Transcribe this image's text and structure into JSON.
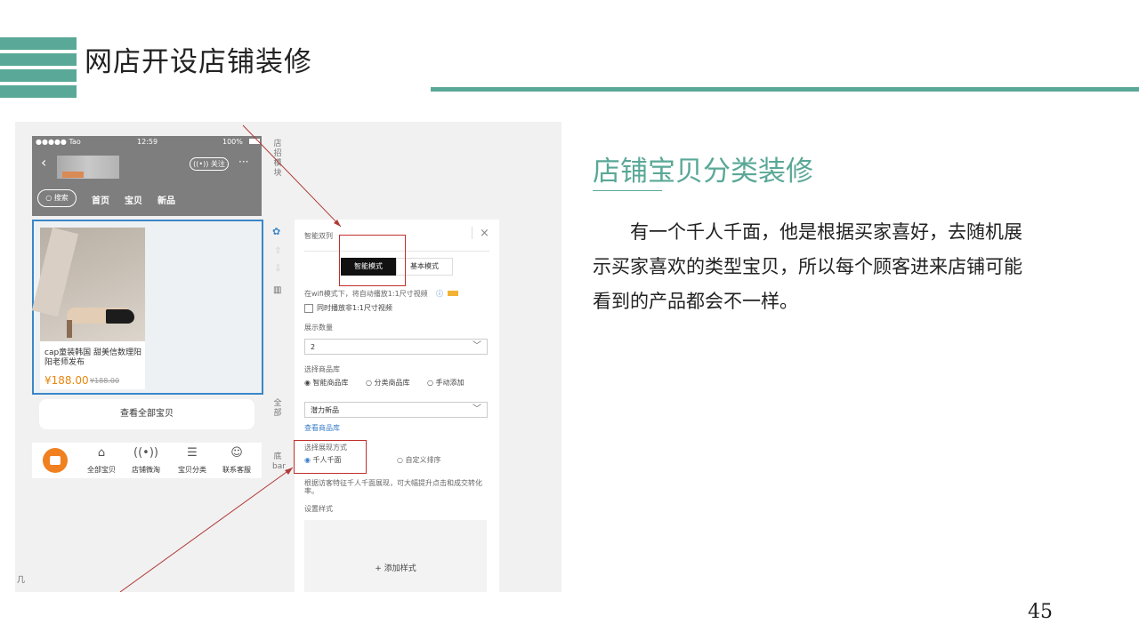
{
  "slide": {
    "title": "网店开设店铺装修",
    "section_title": "店铺宝贝分类装修",
    "paragraph": "有一个千人千面，他是根据买家喜好，去随机展示买家喜欢的类型宝贝，所以每个顾客进来店铺可能看到的产品都会不一样。",
    "page_number": "45",
    "accent_color": "#5aa897"
  },
  "screenshot": {
    "status_bar": {
      "carrier": "●●●●● Tao",
      "time": "12:59",
      "battery": "100%"
    },
    "follow_label": "关注",
    "more_label": "···",
    "nav": {
      "search": "搜索",
      "items": [
        "首页",
        "宝贝",
        "新品"
      ]
    },
    "product": {
      "title": "cap童装韩国 甜美信数理阳阳老师发布",
      "price": "¥188.00",
      "old_price": "¥188.00"
    },
    "view_all": "查看全部宝贝",
    "side_labels": {
      "top": "店招模块",
      "middle": "全部",
      "bottom": "底bar"
    },
    "tabbar": [
      {
        "icon": "bag-icon",
        "label": "全部宝贝"
      },
      {
        "icon": "broadcast-icon",
        "label": "店铺微淘"
      },
      {
        "icon": "list-icon",
        "label": "宝贝分类"
      },
      {
        "icon": "chat-icon",
        "label": "联系客服"
      }
    ],
    "panel": {
      "title": "智能双列",
      "mode_smart": "智能模式",
      "mode_basic": "基本模式",
      "wifi_note": "在wifi模式下，将自动播放1:1尺寸视频",
      "checkbox_label": "同时播放非1:1尺寸视频",
      "count_label": "展示数量",
      "count_value": "2",
      "library_label": "选择商品库",
      "library_options": [
        "智能商品库",
        "分类商品库",
        "手动添加"
      ],
      "library_value": "潜力新品",
      "view_library": "查看商品库",
      "display_label": "选择展现方式",
      "display_options": [
        "千人千面",
        "自定义排序"
      ],
      "display_note": "根据访客特征千人千面展现，可大幅提升点击和成交转化率。",
      "style_label": "设置样式",
      "add_style": "+ 添加样式"
    },
    "corner_char": "几"
  }
}
